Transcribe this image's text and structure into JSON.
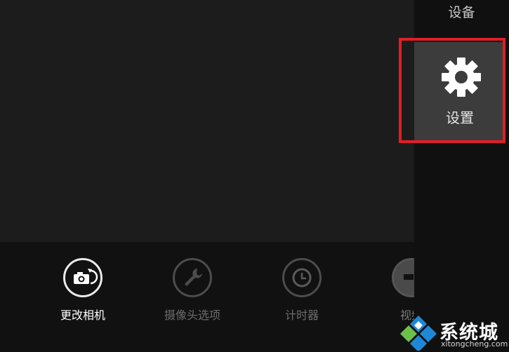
{
  "charms": {
    "title": "设备",
    "settings_label": "设置",
    "settings_icon": "gear-icon"
  },
  "app_bar": {
    "buttons": [
      {
        "label": "更改相机",
        "icon": "camera-switch-icon",
        "enabled": true
      },
      {
        "label": "摄像头选项",
        "icon": "wrench-icon",
        "enabled": false
      },
      {
        "label": "计时器",
        "icon": "clock-icon",
        "enabled": false
      },
      {
        "label": "视频",
        "icon": "video-icon",
        "enabled": false
      }
    ]
  },
  "watermark": {
    "text": "系统城",
    "url_text": "xitongcheng.com"
  },
  "colors": {
    "highlight": "#e01f26",
    "charm_bg": "#101010",
    "tile_bg": "#3c3c3c",
    "logo_blue": "#1e88d8",
    "logo_green": "#6cc04a"
  }
}
